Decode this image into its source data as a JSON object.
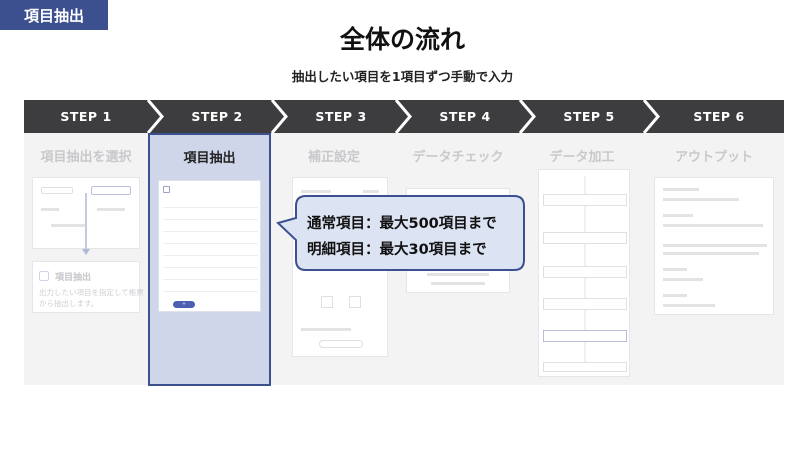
{
  "header": {
    "tag": "項目抽出",
    "title": "全体の流れ",
    "subtitle": "抽出したい項目を1項目ずつ手動で入力"
  },
  "steps": [
    "STEP 1",
    "STEP 2",
    "STEP 3",
    "STEP 4",
    "STEP 5",
    "STEP 6"
  ],
  "columns": [
    {
      "heading": "項目抽出を選択"
    },
    {
      "heading": "項目抽出"
    },
    {
      "heading": "補正設定"
    },
    {
      "heading": "データチェック"
    },
    {
      "heading": "データ加工"
    },
    {
      "heading": "アウトプット"
    }
  ],
  "step1_detail": {
    "card_title": "項目抽出",
    "card_desc_1": "出力したい項目を指定して帳票",
    "card_desc_2": "から抽出します。"
  },
  "callout": {
    "line1": "通常項目：最大500項目まで",
    "line2": "明細項目：最大30項目まで"
  },
  "colors": {
    "tag_bg": "#3c4f8f",
    "step_bar": "#3d3d3f",
    "step_divider": "#ffffff",
    "active_col_bg": "#cfd6ea",
    "active_col_border": "#3c4f8f",
    "callout_bg": "#dce3f2",
    "callout_border": "#3c4f8f"
  }
}
